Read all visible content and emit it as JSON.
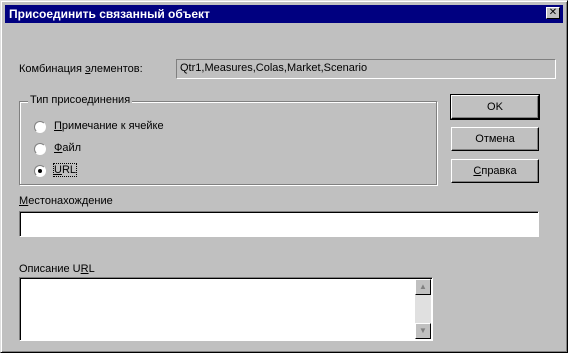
{
  "window": {
    "title": "Присоединить связанный объект",
    "close_glyph": "✕"
  },
  "combination": {
    "label_pre": "Комбинация ",
    "label_mnemonic": "э",
    "label_post": "лементов:",
    "value": "Qtr1,Measures,Colas,Market,Scenario"
  },
  "attach_type": {
    "legend": "Тип присоединения",
    "options": [
      {
        "mnemonic": "П",
        "rest": "римечание к ячейке",
        "selected": false
      },
      {
        "mnemonic": "Ф",
        "rest": "айл",
        "selected": false
      },
      {
        "mnemonic": "U",
        "rest": "RL",
        "selected": true
      }
    ]
  },
  "buttons": {
    "ok": "OK",
    "cancel": "Отмена",
    "help_mnemonic": "С",
    "help_rest": "правка"
  },
  "location": {
    "label_mnemonic": "М",
    "label_rest": "естонахождение",
    "value": ""
  },
  "url_description": {
    "label_pre": "Описание U",
    "label_mnemonic": "R",
    "label_post": "L",
    "value": ""
  },
  "icons": {
    "close": "close-icon",
    "scroll_up": "scroll-up-icon",
    "scroll_down": "scroll-down-icon"
  },
  "colors": {
    "titlebar": "#000080",
    "face": "#c0c0c0"
  }
}
